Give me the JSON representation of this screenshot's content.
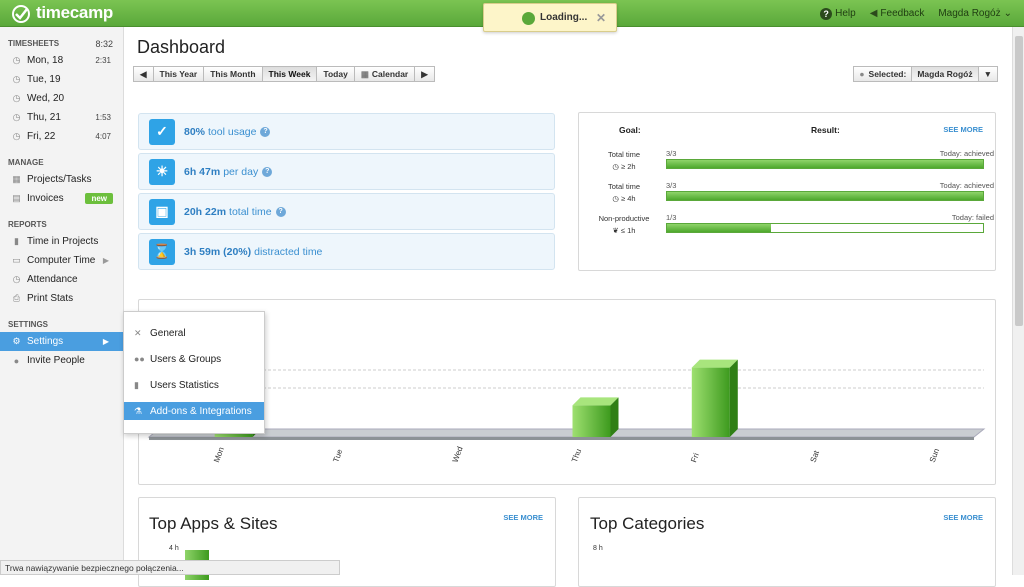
{
  "app": {
    "name": "timecamp"
  },
  "topbar": {
    "help": "Help",
    "feedback": "Feedback",
    "user": "Magda Rogóż"
  },
  "loading": {
    "text": "Loading..."
  },
  "sidebar": {
    "timesheets": {
      "title": "TIMESHEETS",
      "total": "8:32",
      "days": [
        {
          "label": "Mon, 18",
          "value": "2:31"
        },
        {
          "label": "Tue, 19",
          "value": ""
        },
        {
          "label": "Wed, 20",
          "value": ""
        },
        {
          "label": "Thu, 21",
          "value": "1:53"
        },
        {
          "label": "Fri, 22",
          "value": "4:07"
        }
      ]
    },
    "manage": {
      "title": "MANAGE",
      "items": [
        "Projects/Tasks",
        "Invoices"
      ],
      "badge": "new"
    },
    "reports": {
      "title": "REPORTS",
      "items": [
        "Time in Projects",
        "Computer Time",
        "Attendance",
        "Print Stats"
      ]
    },
    "settings": {
      "title": "SETTINGS",
      "items": [
        "Settings",
        "Invite People"
      ]
    }
  },
  "settings_menu": [
    "General",
    "Users & Groups",
    "Users Statistics",
    "Add-ons & Integrations"
  ],
  "dashboard": {
    "title": "Dashboard",
    "range_buttons": [
      "This Year",
      "This Month",
      "This Week",
      "Today",
      "Calendar"
    ],
    "selected_range": "This Week",
    "selected_label": "Selected:",
    "selected_user": "Magda Rogóż",
    "stats": [
      {
        "value": "80%",
        "label": "tool usage"
      },
      {
        "value": "6h 47m",
        "label": "per day"
      },
      {
        "value": "20h 22m",
        "label": "total time"
      },
      {
        "value": "3h 59m (20%)",
        "label": "distracted time"
      }
    ],
    "goals": {
      "goal_header": "Goal:",
      "result_header": "Result:",
      "see_more": "SEE MORE",
      "rows": [
        {
          "name": "Total time",
          "target": "≥ 2h",
          "fraction": "3/3",
          "status": "Today: achieved",
          "progress": 1.0
        },
        {
          "name": "Total time",
          "target": "≥ 4h",
          "fraction": "3/3",
          "status": "Today: achieved",
          "progress": 1.0
        },
        {
          "name": "Non-productive",
          "target": "≤ 1h",
          "fraction": "1/3",
          "status": "Today: failed",
          "progress": 0.33
        }
      ]
    },
    "top_apps": {
      "title": "Top Apps & Sites",
      "see_more": "SEE MORE",
      "tick": "4 h"
    },
    "top_categories": {
      "title": "Top Categories",
      "see_more": "SEE MORE",
      "tick": "8 h"
    }
  },
  "chart_data": {
    "type": "bar",
    "categories": [
      "Mon",
      "Tue",
      "Wed",
      "Thu",
      "Fri",
      "Sat",
      "Sun"
    ],
    "values": [
      2.52,
      0,
      0,
      1.88,
      4.12,
      0,
      0
    ],
    "ylim": [
      0,
      5
    ]
  },
  "statusbar": {
    "text": "Trwa nawiązywanie bezpiecznego połączenia..."
  }
}
